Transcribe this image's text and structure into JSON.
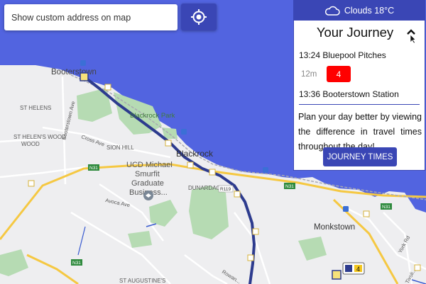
{
  "search": {
    "placeholder": "Show custom address on map"
  },
  "weather": {
    "icon": "cloud-icon",
    "text": "Clouds 18°C"
  },
  "journey": {
    "title": "Your Journey",
    "origin": {
      "time": "13:24",
      "stop": "Bluepool Pitches"
    },
    "leg": {
      "duration": "12m",
      "route": "4",
      "route_color": "#ff0000"
    },
    "destination": {
      "time": "13:36",
      "stop": "Booterstown Station"
    },
    "tip": "Plan your day better by viewing the difference in travel times throughout the day!",
    "button_label": "JOURNEY TIMES"
  },
  "map": {
    "labels": {
      "booterstown": "Booterstown",
      "booterstown_ave": "Booterstown Ave",
      "st_helens": "ST HELENS",
      "st_helens_wood": "ST HELEN'S WOOD",
      "cross_ave": "Cross Ave",
      "sion_hill": "SION HILL",
      "blackrock_park": "Blackrock Park",
      "blackrock": "Blackrock",
      "ucd_1": "UCD Michael",
      "ucd_2": "Smurfit",
      "ucd_3": "Graduate",
      "ucd_4": "Business...",
      "dunardagh": "DUNARDAGH",
      "avoca_ave": "Avoca Ave",
      "monkstown": "Monkstown",
      "york_rd": "York Rd",
      "rowanbyrn": "Rowan...",
      "st_augustines": "ST AUGUSTINE'S",
      "tivoli": "Tivoli..."
    },
    "road_shields": {
      "n31": "N31",
      "r119": "R119"
    },
    "bus_marker_route": "4",
    "colors": {
      "sea": "#5264e0",
      "land": "#eeeef0",
      "park": "#b6dbb3",
      "route": "#2d3b8e",
      "major_road": "#f5c842"
    }
  }
}
